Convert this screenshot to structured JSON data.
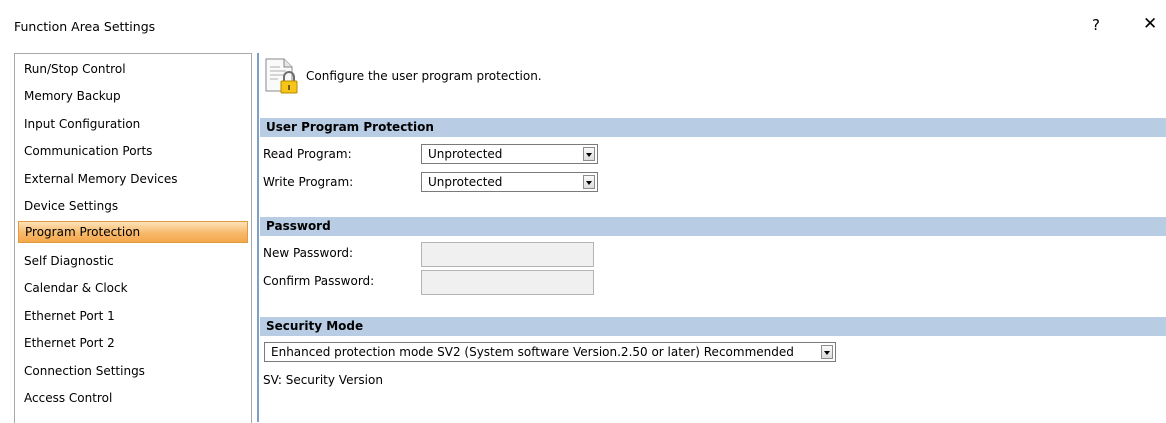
{
  "window": {
    "title": "Function Area Settings",
    "help_glyph": "?",
    "close_glyph": "✕"
  },
  "sidebar": {
    "items": [
      {
        "label": "Run/Stop Control",
        "selected": false
      },
      {
        "label": "Memory Backup",
        "selected": false
      },
      {
        "label": "Input Configuration",
        "selected": false
      },
      {
        "label": "Communication Ports",
        "selected": false
      },
      {
        "label": "External Memory Devices",
        "selected": false
      },
      {
        "label": "Device Settings",
        "selected": false
      },
      {
        "label": "Program Protection",
        "selected": true
      },
      {
        "label": "Self Diagnostic",
        "selected": false
      },
      {
        "label": "Calendar & Clock",
        "selected": false
      },
      {
        "label": "Ethernet Port 1",
        "selected": false
      },
      {
        "label": "Ethernet Port 2",
        "selected": false
      },
      {
        "label": "Connection Settings",
        "selected": false
      },
      {
        "label": "Access Control",
        "selected": false
      }
    ]
  },
  "main": {
    "header_icon": "locked-document-icon",
    "description": "Configure the user program protection.",
    "user_program_protection": {
      "title": "User Program Protection",
      "read_label": "Read Program:",
      "read_value": "Unprotected",
      "write_label": "Write Program:",
      "write_value": "Unprotected"
    },
    "password": {
      "title": "Password",
      "new_label": "New Password:",
      "new_value": "",
      "confirm_label": "Confirm Password:",
      "confirm_value": ""
    },
    "security_mode": {
      "title": "Security Mode",
      "value": "Enhanced protection mode SV2 (System software Version.2.50 or later) Recommended",
      "note": "SV: Security Version"
    }
  },
  "colors": {
    "section_header": "#b8cce4",
    "selected_item": "#f7b96a",
    "divider": "#7f9fc6"
  }
}
